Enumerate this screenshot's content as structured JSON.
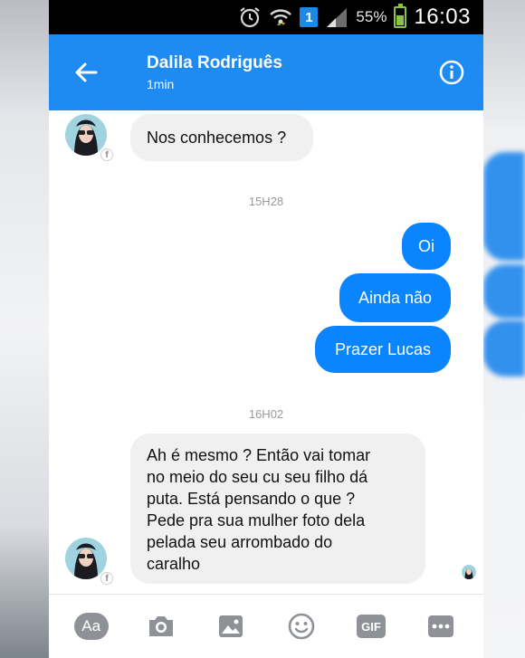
{
  "status_bar": {
    "sim_badge": "1",
    "battery_text": "55%",
    "battery_level": 0.55,
    "time": "16:03",
    "icons": [
      "alarm-icon",
      "wifi-icon",
      "sim-icon",
      "signal-icon",
      "battery-icon"
    ]
  },
  "header": {
    "back_icon": "arrow-left-icon",
    "contact_name": "Dalila Rodriguês",
    "last_active": "1min",
    "info_icon": "info-icon",
    "background_color": "#1d8bf1"
  },
  "messages": [
    {
      "type": "incoming",
      "text": "Nos conhecemos ?"
    },
    {
      "type": "timestamp",
      "text": "15H28"
    },
    {
      "type": "outgoing",
      "text": "Oi"
    },
    {
      "type": "outgoing",
      "text": "Ainda não"
    },
    {
      "type": "outgoing",
      "text": "Prazer Lucas"
    },
    {
      "type": "timestamp",
      "text": "16H02"
    },
    {
      "type": "incoming",
      "text": "Ah é mesmo ? Então vai tomar\nno meio do seu cu seu filho dá\nputa. Está pensando o que ?\nPede pra sua mulher foto dela\npelada seu arrombado do\ncaralho"
    }
  ],
  "composer": {
    "text_button_label": "Aa",
    "gif_label": "GIF",
    "tools": [
      "text-icon",
      "camera-icon",
      "image-icon",
      "emoji-icon",
      "gif-icon",
      "more-icon"
    ]
  },
  "colors": {
    "outgoing_bubble": "#0a84ff",
    "incoming_bubble": "#f0f0f0",
    "timestamp_text": "#9a9a9a",
    "toolbar_icon": "#8e9297"
  }
}
